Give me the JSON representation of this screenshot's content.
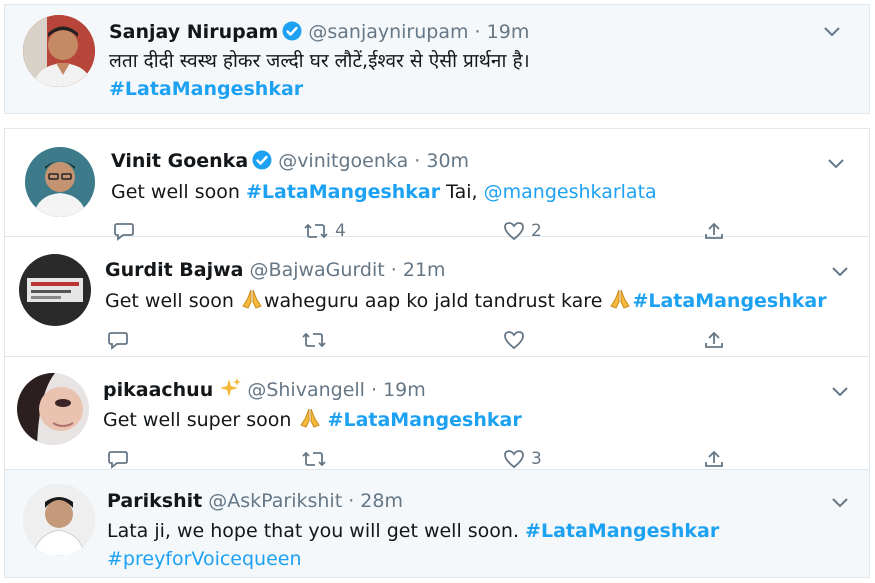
{
  "tweets": [
    {
      "name": "Sanjay Nirupam",
      "verified": true,
      "handle": "@sanjaynirupam",
      "time": "19m",
      "line1": "लता दीदी स्वस्थ होकर जल्दी घर लौटें,ईश्वर से ऐसी प्रार्थना है।",
      "line2_hashtag": "#LataMangeshkar"
    },
    {
      "name": "Vinit Goenka",
      "verified": true,
      "handle": "@vinitgoenka",
      "time": "30m",
      "text_before": "Get well soon ",
      "hashtag": "#LataMangeshkar",
      "text_mid": " Tai, ",
      "mention": "@mangeshkarlata",
      "actions": {
        "retweets": "4",
        "likes": "2"
      }
    },
    {
      "name": "Gurdit Bajwa",
      "handle": "@BajwaGurdit",
      "time": "21m",
      "text_before": "Get well soon ",
      "text_mid": "waheguru aap ko jald tandrust kare ",
      "hashtag": "#LataMangeshkar"
    },
    {
      "name": "pikaachuu",
      "handle": "@Shivangell",
      "time": "19m",
      "text_before": "Get well super soon ",
      "hashtag": "#LataMangeshkar",
      "actions": {
        "likes": "3"
      }
    },
    {
      "name": "Parikshit",
      "handle": "@AskParikshit",
      "time": "28m",
      "text_before": "Lata ji, we hope that you will get well soon. ",
      "hashtag": "#LataMangeshkar",
      "line2_hashtag": "#preyforVoicequeen"
    }
  ],
  "dot": "·",
  "colors": {
    "link": "#1da1f2",
    "muted": "#657786",
    "panel_bg": "#f5f8fa",
    "border": "#e1e8ed"
  }
}
